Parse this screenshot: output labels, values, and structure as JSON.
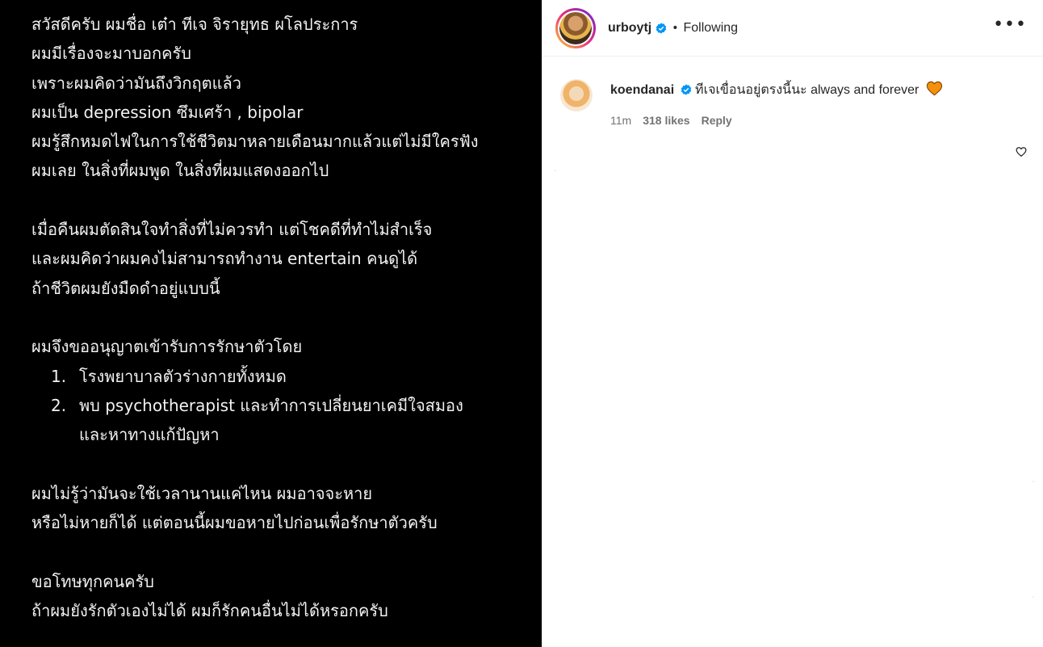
{
  "post_text": {
    "lines_a": [
      "สวัสดีครับ ผมชื่อ เต๋า ทีเจ จิรายุทธ ผโลประการ",
      "ผมมีเรื่องจะมาบอกครับ",
      "เพราะผมคิดว่ามันถึงวิกฤตแล้ว",
      "ผมเป็น depression ซึมเศร้า , bipolar",
      "ผมรู้สึกหมดไฟในการใช้ชีวิตมาหลายเดือนมากแล้วแต่ไม่มีใครฟัง",
      "ผมเลย ในสิ่งที่ผมพูด ในสิ่งที่ผมแสดงออกไป"
    ],
    "lines_b": [
      "เมื่อคืนผมตัดสินใจทำสิ่งที่ไม่ควรทำ แต่โชคดีที่ทำไม่สำเร็จ",
      "และผมคิดว่าผมคงไม่สามารถทำงาน entertain คนดูได้",
      "ถ้าชีวิตผมยังมืดดำอยู่แบบนี้"
    ],
    "line_c": "ผมจึงขออนุญาตเข้ารับการรักษาตัวโดย",
    "list": [
      {
        "num": "1.",
        "text": "โรงพยาบาลตัวร่างกายทั้งหมด"
      },
      {
        "num": "2.",
        "text": "พบ psychotherapist และทำการเปลี่ยนยาเคมีใจสมอง"
      }
    ],
    "list_cont": "และหาทางแก้ปัญหา",
    "lines_d": [
      "ผมไม่รู้ว่ามันจะใช้เวลานานแค่ไหน ผมอาจจะหาย",
      "หรือไม่หายก็ได้ แต่ตอนนี้ผมขอหายไปก่อนเพื่อรักษาตัวครับ"
    ],
    "lines_e": [
      "ขอโทษทุกคนครับ",
      "ถ้าผมยังรักตัวเองไม่ได้ ผมก็รักคนอื่นไม่ได้หรอกครับ"
    ]
  },
  "header": {
    "username": "urboytj",
    "separator": "•",
    "follow_status": "Following",
    "more_label": "•••"
  },
  "comment": {
    "username": "koendanai",
    "text": "ทีเจเขื่อนอยู่ตรงนี้นะ always and forever",
    "time": "11m",
    "likes": "318 likes",
    "reply_label": "Reply"
  },
  "colors": {
    "verified": "#0095f6",
    "heart": "#f4900c",
    "story_ring": [
      "#f9ce34",
      "#ee2a7b",
      "#6228d7"
    ]
  },
  "icons": {
    "verified": "verified-badge-icon",
    "like": "heart-outline-icon",
    "emoji": "orange-heart-emoji",
    "more": "more-options-icon"
  }
}
